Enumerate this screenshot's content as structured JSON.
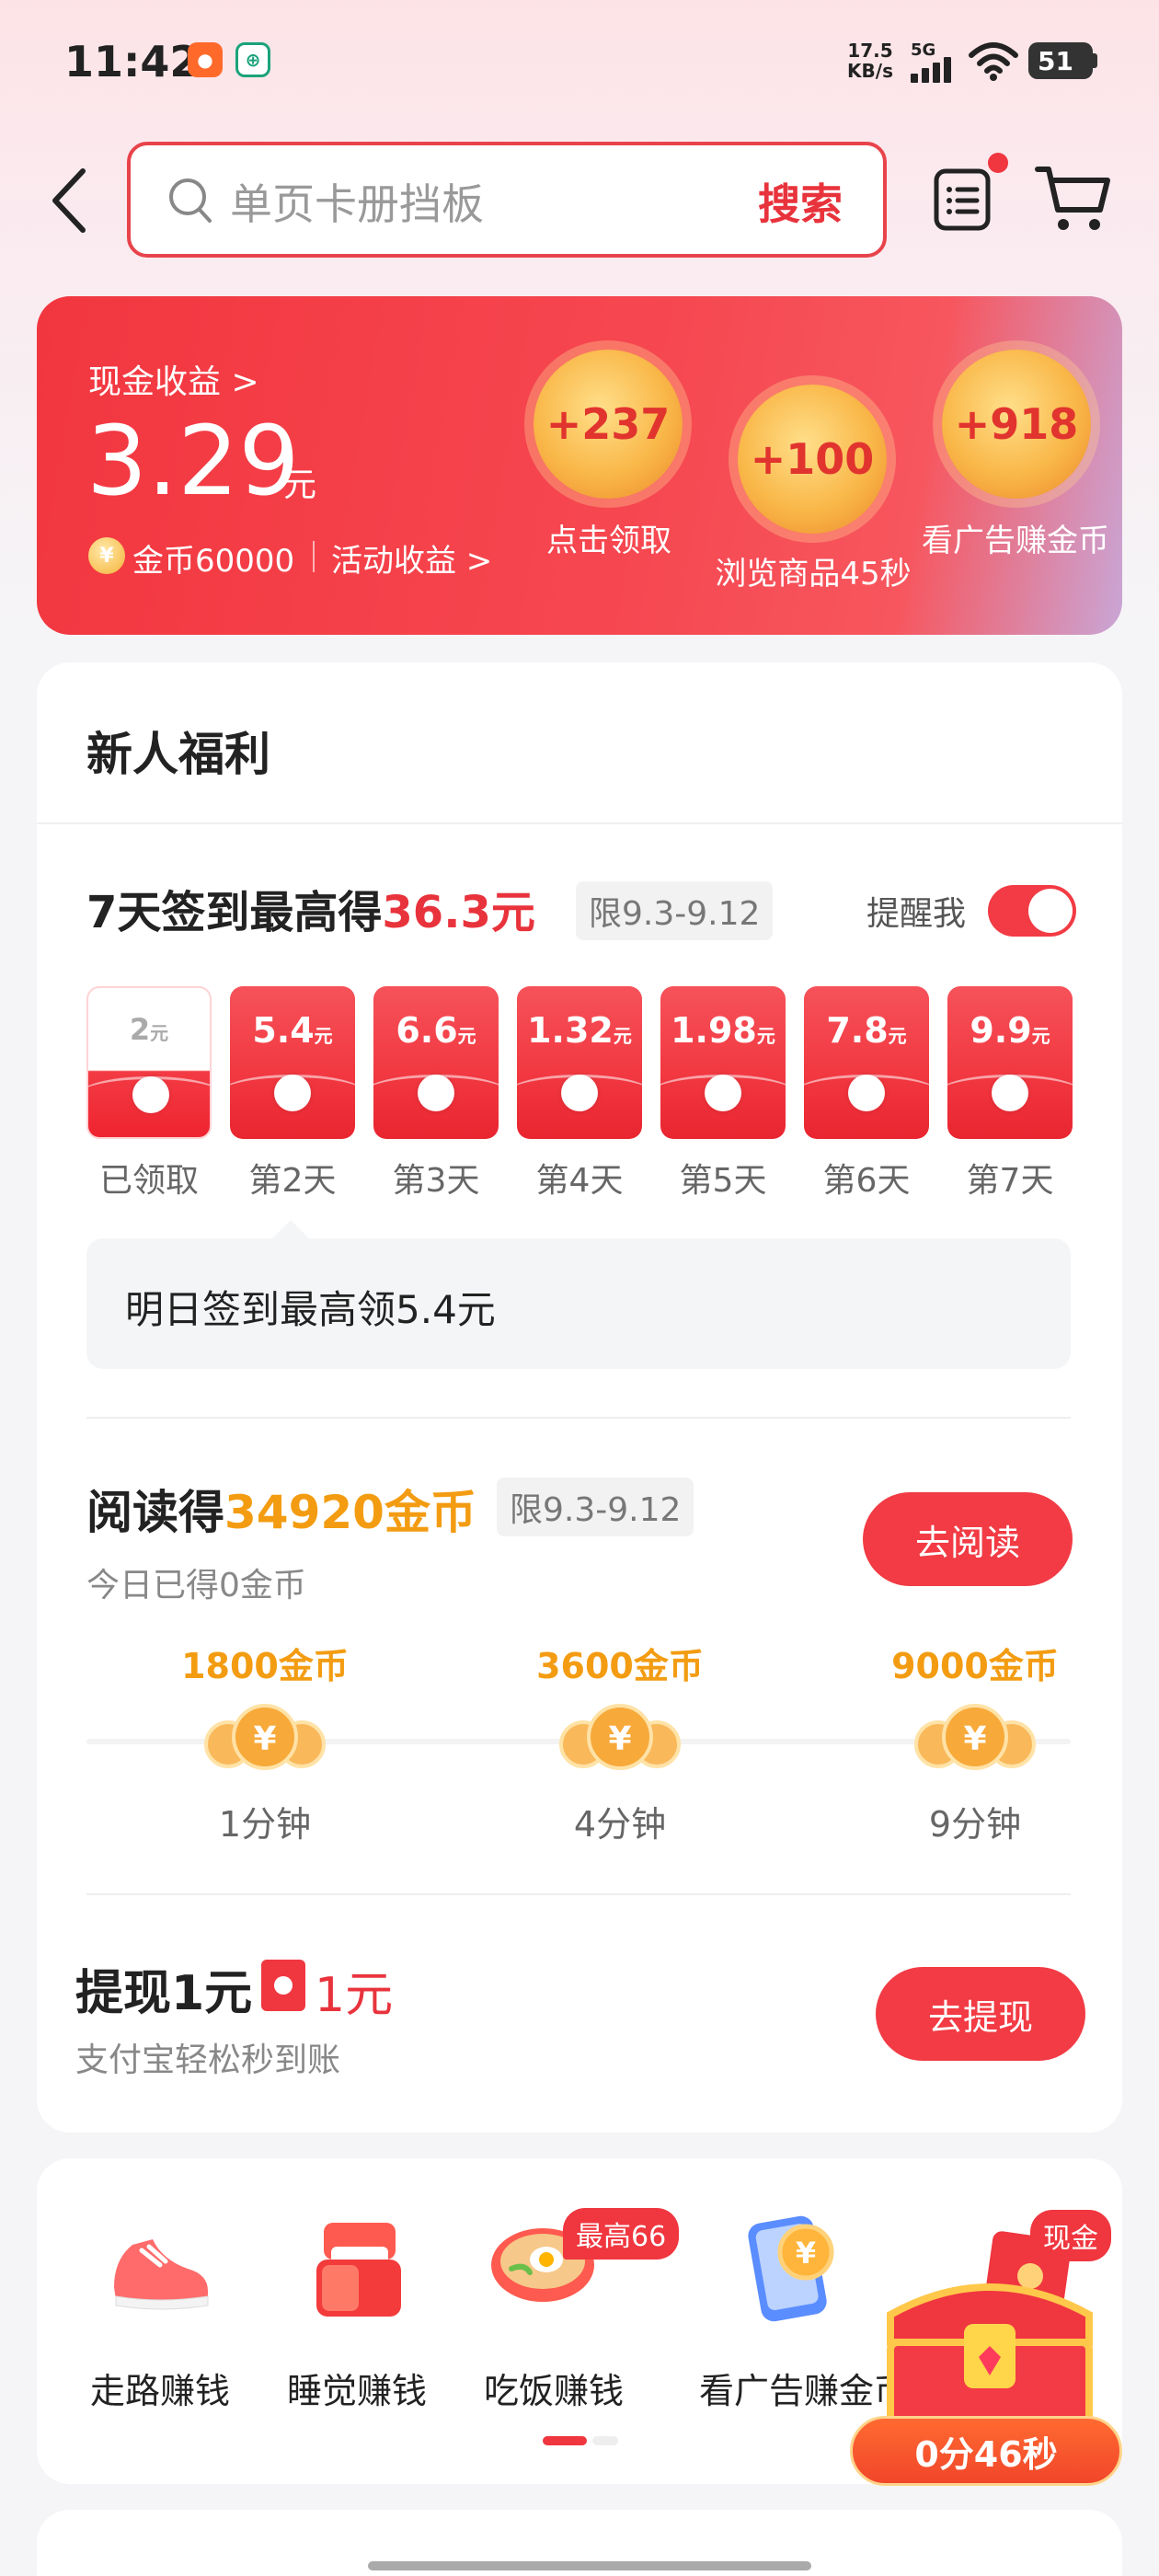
{
  "status_bar": {
    "time": "11:42",
    "net_speed_value": "17.5",
    "net_speed_unit": "KB/s",
    "network": "5G",
    "battery": "51",
    "app_icons": [
      "pinduoduo-icon",
      "bank-icon"
    ]
  },
  "header": {
    "search_placeholder": "单页卡册挡板",
    "search_button": "搜索",
    "has_notification_dot": true
  },
  "banner": {
    "cash_label": "现金收益 >",
    "cash_value": "3.29",
    "cash_unit": "元",
    "coin_symbol": "¥",
    "coins_text": "金币60000",
    "activity_text": "活动收益 >",
    "bubbles": [
      {
        "value": "+237",
        "label": "点击领取"
      },
      {
        "value": "+100",
        "label": "浏览商品45秒"
      },
      {
        "value": "+918",
        "label": "看广告赚金币"
      }
    ]
  },
  "welfare": {
    "title": "新人福利",
    "sign": {
      "title_prefix": "7天签到最高得",
      "title_amount": "36.3元",
      "date_tag": "限9.3-9.12",
      "remind_label": "提醒我",
      "remind_on": true,
      "days": [
        {
          "amount": "2",
          "unit": "元",
          "label": "已领取",
          "claimed": true
        },
        {
          "amount": "5.4",
          "unit": "元",
          "label": "第2天",
          "claimed": false
        },
        {
          "amount": "6.6",
          "unit": "元",
          "label": "第3天",
          "claimed": false
        },
        {
          "amount": "1.32",
          "unit": "元",
          "label": "第4天",
          "claimed": false
        },
        {
          "amount": "1.98",
          "unit": "元",
          "label": "第5天",
          "claimed": false
        },
        {
          "amount": "7.8",
          "unit": "元",
          "label": "第6天",
          "claimed": false
        },
        {
          "amount": "9.9",
          "unit": "元",
          "label": "第7天",
          "claimed": false
        }
      ],
      "tomorrow_text": "明日签到最高领5.4元"
    },
    "reading": {
      "title_prefix": "阅读得",
      "title_amount": "34920金币",
      "date_tag": "限9.3-9.12",
      "subtitle": "今日已得0金币",
      "button": "去阅读",
      "coin_symbol": "¥",
      "milestones": [
        {
          "reward": "1800金币",
          "time": "1分钟"
        },
        {
          "reward": "3600金币",
          "time": "4分钟"
        },
        {
          "reward": "9000金币",
          "time": "9分钟"
        }
      ]
    },
    "withdraw": {
      "title": "提现1元",
      "amount": "1元",
      "subtitle": "支付宝轻松秒到账",
      "button": "去提现"
    }
  },
  "tasks": {
    "items": [
      {
        "label": "走路赚钱",
        "icon": "sneaker-icon",
        "badge": ""
      },
      {
        "label": "睡觉赚钱",
        "icon": "bed-icon",
        "badge": ""
      },
      {
        "label": "吃饭赚钱",
        "icon": "noodle-bowl-icon",
        "badge": "最高66"
      },
      {
        "label": "看广告赚金币",
        "icon": "phone-coin-icon",
        "badge": ""
      },
      {
        "label": "",
        "icon": "red-envelope-icon",
        "badge": "现金"
      }
    ],
    "chest_timer": "0分46秒"
  },
  "colors": {
    "accent_red": "#f23b44",
    "coin_orange": "#f39c12"
  }
}
